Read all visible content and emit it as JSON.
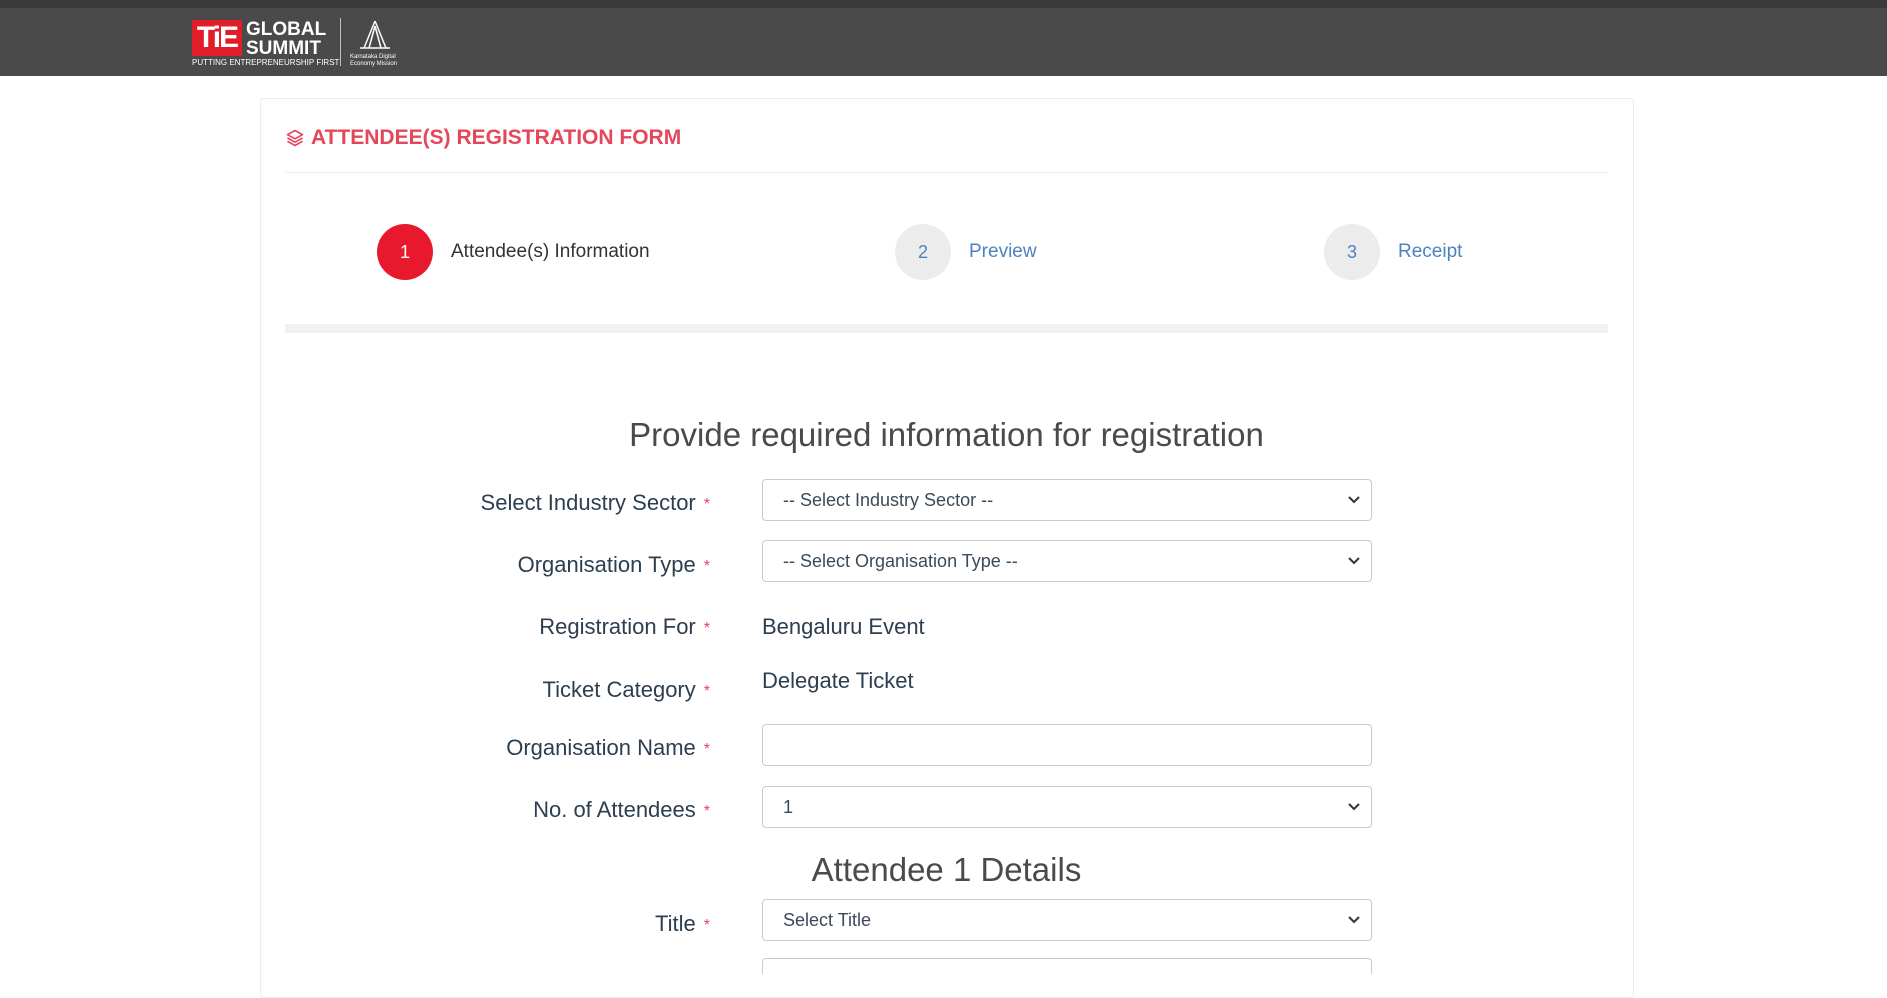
{
  "header": {
    "logo_tie": "TiE",
    "logo_line1": "GLOBAL",
    "logo_line2": "SUMMIT",
    "logo_tagline": "PUTTING ENTREPRENEURSHIP FIRST",
    "partner_text": "Karnataka Digital Economy Mission",
    "background_color": "#4a4a4a",
    "brand_red": "#e11d2a"
  },
  "form": {
    "title": "ATTENDEE(S) REGISTRATION FORM",
    "title_color": "#e5475a"
  },
  "steps": [
    {
      "number": "1",
      "label": "Attendee(s) Information",
      "state": "active"
    },
    {
      "number": "2",
      "label": "Preview",
      "state": "idle"
    },
    {
      "number": "3",
      "label": "Receipt",
      "state": "idle"
    }
  ],
  "main": {
    "heading": "Provide required information for registration",
    "required_marker": "*",
    "fields": {
      "industry_sector": {
        "label": "Select Industry Sector",
        "value": "-- Select Industry Sector --"
      },
      "organisation_type": {
        "label": "Organisation Type",
        "value": "-- Select Organisation Type --"
      },
      "registration_for": {
        "label": "Registration For",
        "value": "Bengaluru Event"
      },
      "ticket_category": {
        "label": "Ticket Category",
        "value": "Delegate Ticket"
      },
      "organisation_name": {
        "label": "Organisation Name",
        "value": "",
        "placeholder": ""
      },
      "num_attendees": {
        "label": "No. of Attendees",
        "value": "1"
      }
    },
    "attendee_heading": "Attendee 1 Details",
    "attendee_fields": {
      "title": {
        "label": "Title",
        "value": "Select Title"
      }
    }
  }
}
